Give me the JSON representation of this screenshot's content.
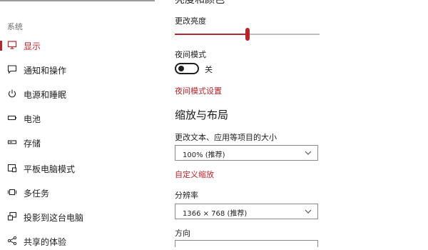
{
  "sidebar": {
    "section_label": "系统",
    "items": [
      {
        "label": "显示",
        "icon": "monitor-icon",
        "active": true
      },
      {
        "label": "通知和操作",
        "icon": "message-icon",
        "active": false
      },
      {
        "label": "电源和睡眠",
        "icon": "power-icon",
        "active": false
      },
      {
        "label": "电池",
        "icon": "battery-icon",
        "active": false
      },
      {
        "label": "存储",
        "icon": "storage-icon",
        "active": false
      },
      {
        "label": "平板电脑模式",
        "icon": "tablet-mode-icon",
        "active": false
      },
      {
        "label": "多任务",
        "icon": "multitask-icon",
        "active": false
      },
      {
        "label": "投影到这台电脑",
        "icon": "project-icon",
        "active": false
      },
      {
        "label": "共享的体验",
        "icon": "share-icon",
        "active": false
      }
    ]
  },
  "main": {
    "partial_heading": "亮度和颜色",
    "brightness": {
      "label": "更改亮度",
      "value": 0.5
    },
    "night_mode": {
      "label": "夜间模式",
      "state_label": "关",
      "on": false
    },
    "night_mode_settings_link": "夜间模式设置",
    "scale_layout": {
      "title": "缩放与布局",
      "text_size_label": "更改文本、应用等项目的大小",
      "text_size_value": "100% (推荐)",
      "custom_scale_link": "自定义缩放",
      "resolution_label": "分辨率",
      "resolution_value": "1366 × 768 (推荐)",
      "orientation_label": "方向"
    }
  },
  "colors": {
    "accent": "#b3262b",
    "text": "#1a1a1a",
    "muted": "#6e6e6e"
  }
}
